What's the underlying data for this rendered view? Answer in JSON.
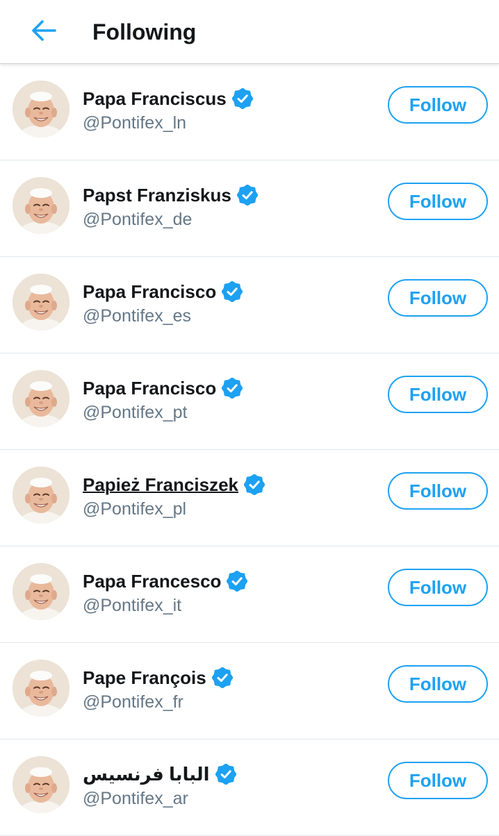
{
  "header": {
    "title": "Following",
    "back_icon": "arrow-left-icon",
    "accent_color": "#1da1f2"
  },
  "accounts": [
    {
      "name": "Papa Franciscus",
      "handle": "@Pontifex_ln",
      "verified": true,
      "button": "Follow"
    },
    {
      "name": "Papst Franziskus",
      "handle": "@Pontifex_de",
      "verified": true,
      "button": "Follow"
    },
    {
      "name": "Papa Francisco",
      "handle": "@Pontifex_es",
      "verified": true,
      "button": "Follow"
    },
    {
      "name": "Papa Francisco",
      "handle": "@Pontifex_pt",
      "verified": true,
      "button": "Follow"
    },
    {
      "name": "Papież Franciszek",
      "handle": "@Pontifex_pl",
      "verified": true,
      "button": "Follow",
      "underlined": true
    },
    {
      "name": "Papa Francesco",
      "handle": "@Pontifex_it",
      "verified": true,
      "button": "Follow"
    },
    {
      "name": "Pape François",
      "handle": "@Pontifex_fr",
      "verified": true,
      "button": "Follow"
    },
    {
      "name": "البابا فرنسيس",
      "handle": "@Pontifex_ar",
      "verified": true,
      "button": "Follow"
    }
  ]
}
